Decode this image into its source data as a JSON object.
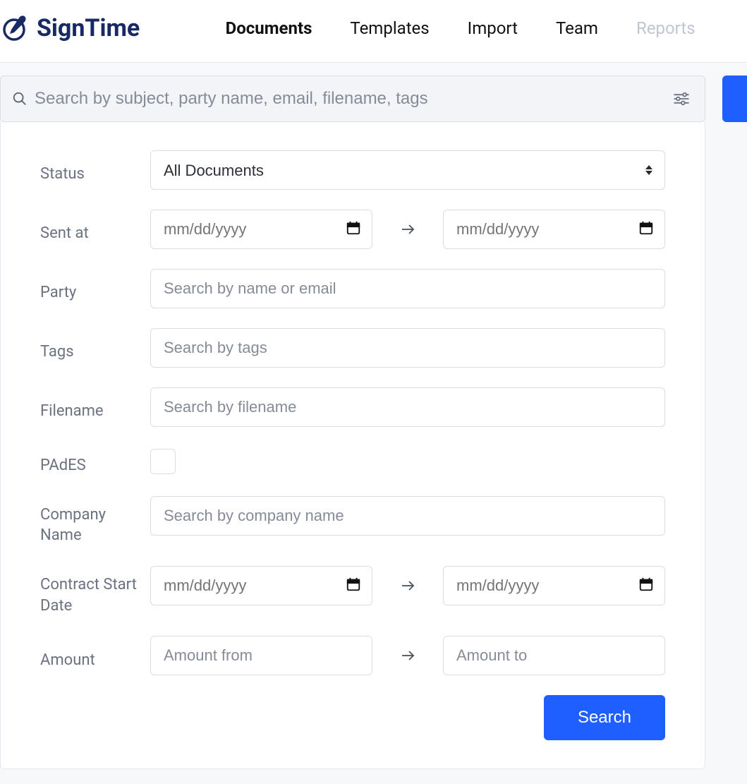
{
  "brand": {
    "name": "SignTime"
  },
  "nav": {
    "items": [
      {
        "label": "Documents",
        "active": true
      },
      {
        "label": "Templates",
        "active": false
      },
      {
        "label": "Import",
        "active": false
      },
      {
        "label": "Team",
        "active": false
      },
      {
        "label": "Reports",
        "active": false,
        "disabled": true
      }
    ]
  },
  "search": {
    "placeholder": "Search by subject, party name, email, filename, tags"
  },
  "filters": {
    "status": {
      "label": "Status",
      "selected": "All Documents"
    },
    "sent_at": {
      "label": "Sent at",
      "from_placeholder": "mm/dd/yyyy",
      "to_placeholder": "mm/dd/yyyy"
    },
    "party": {
      "label": "Party",
      "placeholder": "Search by name or email"
    },
    "tags": {
      "label": "Tags",
      "placeholder": "Search by tags"
    },
    "filename": {
      "label": "Filename",
      "placeholder": "Search by filename"
    },
    "pades": {
      "label": "PAdES",
      "checked": false
    },
    "company_name": {
      "label": "Company Name",
      "placeholder": "Search by company name"
    },
    "contract_start_date": {
      "label": "Contract Start Date",
      "from_placeholder": "mm/dd/yyyy",
      "to_placeholder": "mm/dd/yyyy"
    },
    "amount": {
      "label": "Amount",
      "from_placeholder": "Amount from",
      "to_placeholder": "Amount to"
    },
    "search_button": "Search"
  }
}
